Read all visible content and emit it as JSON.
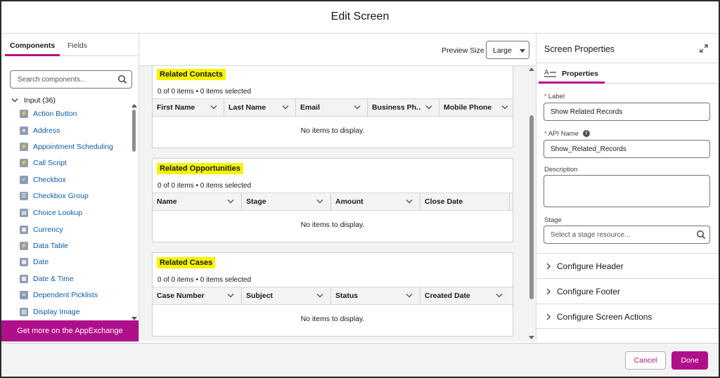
{
  "header": {
    "title": "Edit Screen"
  },
  "left_panel": {
    "tabs": [
      {
        "label": "Components",
        "active": true
      },
      {
        "label": "Fields",
        "active": false
      }
    ],
    "search_placeholder": "Search components...",
    "group": {
      "label": "Input (36)"
    },
    "components": [
      {
        "label": "Action Button",
        "icon": "bolt-icon"
      },
      {
        "label": "Address",
        "icon": "location-icon"
      },
      {
        "label": "Appointment Scheduling",
        "icon": "bolt-icon"
      },
      {
        "label": "Call Script",
        "icon": "bolt-icon"
      },
      {
        "label": "Checkbox",
        "icon": "checkbox-icon"
      },
      {
        "label": "Checkbox Group",
        "icon": "checkbox-group-icon"
      },
      {
        "label": "Choice Lookup",
        "icon": "lookup-icon"
      },
      {
        "label": "Currency",
        "icon": "currency-icon"
      },
      {
        "label": "Data Table",
        "icon": "bolt-icon"
      },
      {
        "label": "Date",
        "icon": "calendar-icon"
      },
      {
        "label": "Date & Time",
        "icon": "datetime-icon"
      },
      {
        "label": "Dependent Picklists",
        "icon": "picklist-icon"
      },
      {
        "label": "Display Image",
        "icon": "image-icon"
      }
    ],
    "appexchange_label": "Get more on the AppExchange"
  },
  "center": {
    "preview_label": "Preview Size",
    "preview_value": "Large",
    "cards": [
      {
        "title": "Related Contacts",
        "subtitle": "0 of 0 items • 0 items selected",
        "columns": [
          "First Name",
          "Last Name",
          "Email",
          "Business Ph...",
          "Mobile Phone"
        ],
        "empty": "No items to display."
      },
      {
        "title": "Related Opportunities",
        "subtitle": "0 of 0 items • 0 items selected",
        "columns": [
          "Name",
          "Stage",
          "Amount",
          "Close Date"
        ],
        "empty": "No items to display."
      },
      {
        "title": "Related Cases",
        "subtitle": "0 of 0 items • 0 items selected",
        "columns": [
          "Case Number",
          "Subject",
          "Status",
          "Created Date"
        ],
        "empty": "No items to display."
      }
    ]
  },
  "right_panel": {
    "title": "Screen Properties",
    "tab_label": "Properties",
    "label_field": {
      "label": "Label",
      "value": "Show Related Records"
    },
    "api_field": {
      "label": "API Name",
      "value": "Show_Related_Records"
    },
    "description_label": "Description",
    "stage_label": "Stage",
    "stage_placeholder": "Select a stage resource...",
    "sections": [
      "Configure Header",
      "Configure Footer",
      "Configure Screen Actions"
    ]
  },
  "footer": {
    "cancel_label": "Cancel",
    "done_label": "Done"
  },
  "colors": {
    "accent": "#b00f8a",
    "highlight": "#f7f300",
    "link": "#0b5cab"
  }
}
